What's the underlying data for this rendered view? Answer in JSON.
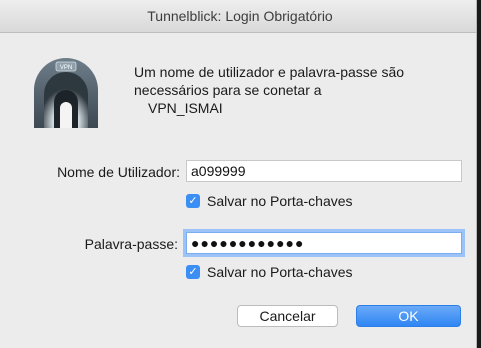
{
  "window": {
    "title": "Tunnelblick: Login Obrigatório"
  },
  "icon": {
    "badge_text": "VPN"
  },
  "message": {
    "line1": "Um nome de utilizador e palavra-passe são",
    "line2": "necessários para se conetar a",
    "line3": "VPN_ISMAI"
  },
  "username": {
    "label": "Nome de Utilizador:",
    "value": "a099999"
  },
  "save_username": {
    "label": "Salvar no Porta-chaves",
    "checked": true
  },
  "password": {
    "label": "Palavra-passe:",
    "masked_value": "●●●●●●●●●●●●"
  },
  "save_password": {
    "label": "Salvar no Porta-chaves",
    "checked": true
  },
  "buttons": {
    "cancel": "Cancelar",
    "ok": "OK"
  },
  "colors": {
    "accent": "#3b8ef3"
  }
}
